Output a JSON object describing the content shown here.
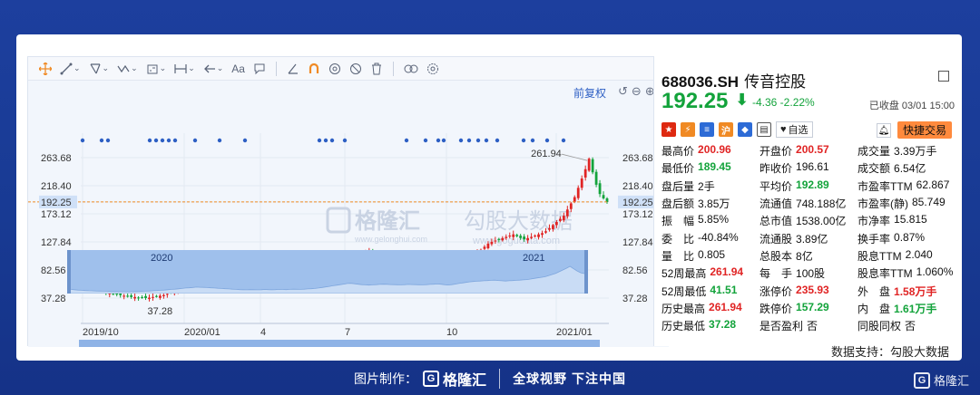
{
  "toolbar": {
    "icons": [
      "crosshair-icon",
      "line-icon",
      "fib-icon",
      "polyline-icon",
      "rect-tool-icon",
      "measure-icon",
      "arrow-icon",
      "text-icon",
      "comment-icon",
      "angle-icon",
      "magnet-icon",
      "eye-icon",
      "hide-icon",
      "trash-icon",
      "link-icon",
      "settings-icon"
    ],
    "text_tool_label": "Aa",
    "accent_color": "#f08a24"
  },
  "chart_controls": {
    "adjust_label": "前复权"
  },
  "watermark": {
    "brand": "格隆汇",
    "brand_sub": "www.gelonghui.com",
    "brand2": "勾股大数据",
    "brand2_sub": "www.gogudata.com"
  },
  "chart_data": {
    "type": "candlestick",
    "y_ticks_left": [
      "263.68",
      "218.40",
      "192.25",
      "173.12",
      "127.84",
      "82.56",
      "37.28"
    ],
    "y_ticks_right": [
      "263.68",
      "218.40",
      "192.25",
      "173.12",
      "127.84",
      "82.56",
      "37.28"
    ],
    "ylim": [
      37.28,
      263.68
    ],
    "x_ticks": [
      "2019/10",
      "2020/01",
      "4",
      "7",
      "10",
      "2021/01"
    ],
    "annotations": {
      "high_label": "261.94",
      "low_label": "37.28"
    },
    "last_price": "192.25",
    "navigator_labels": [
      "2020",
      "2021"
    ],
    "up_color": "#e02424",
    "down_color": "#13a33b",
    "series_close_estimate": [
      62,
      58,
      55,
      52,
      50,
      48,
      46,
      45,
      44,
      43,
      42,
      41,
      40,
      39,
      39,
      38,
      38,
      37.3,
      38,
      39,
      40,
      41,
      42,
      44,
      46,
      48,
      50,
      52,
      55,
      58,
      60,
      63,
      66,
      70,
      72,
      75,
      78,
      77,
      76,
      74,
      72,
      70,
      68,
      66,
      64,
      62,
      60,
      58,
      56,
      55,
      54,
      56,
      55,
      54,
      55,
      57,
      56,
      55,
      56,
      58,
      57,
      56,
      58,
      60,
      59,
      58,
      60,
      62,
      64,
      66,
      70,
      75,
      80,
      85,
      90,
      95,
      100,
      105,
      110,
      112,
      108,
      104,
      100,
      98,
      96,
      98,
      100,
      102,
      104,
      103,
      101,
      100,
      99,
      98,
      100,
      102,
      101,
      100,
      99,
      98,
      100,
      102,
      104,
      106,
      104,
      100,
      97,
      100,
      105,
      110,
      115,
      120,
      125,
      128,
      130,
      132,
      134,
      136,
      138,
      140,
      137,
      134,
      132,
      134,
      136,
      138,
      140,
      142,
      145,
      150,
      155,
      160,
      165,
      170,
      180,
      190,
      200,
      215,
      230,
      245,
      261.94,
      240,
      220,
      205,
      198,
      192.25
    ]
  },
  "quote": {
    "code": "688036.SH",
    "name": "传音控股",
    "price": "192.25",
    "arrow": "⬇",
    "change": "-4.36  -2.22%",
    "status": "已收盘 03/01 15:00",
    "favorite_label": "自选",
    "trade_label": "快捷交易",
    "icons": [
      "china-flag-icon",
      "lightning-icon",
      "database-icon",
      "sh-icon",
      "tag-icon",
      "doc-icon"
    ],
    "rows": [
      [
        [
          "最高价",
          "200.96",
          "up"
        ],
        [
          "开盘价",
          "200.57",
          "up"
        ],
        [
          "成交量",
          "3.39万手",
          ""
        ]
      ],
      [
        [
          "最低价",
          "189.45",
          "down"
        ],
        [
          "昨收价",
          "196.61",
          ""
        ],
        [
          "成交额",
          "6.54亿",
          ""
        ]
      ],
      [
        [
          "盘后量",
          "2手",
          ""
        ],
        [
          "平均价",
          "192.89",
          "down"
        ],
        [
          "市盈率TTM",
          "62.867",
          ""
        ]
      ],
      [
        [
          "盘后额",
          "3.85万",
          ""
        ],
        [
          "流通值",
          "748.188亿",
          ""
        ],
        [
          "市盈率(静)",
          "85.749",
          ""
        ]
      ],
      [
        [
          "振　幅",
          "5.85%",
          ""
        ],
        [
          "总市值",
          "1538.00亿",
          ""
        ],
        [
          "市净率",
          "15.815",
          ""
        ]
      ],
      [
        [
          "委　比",
          "-40.84%",
          ""
        ],
        [
          "流通股",
          "3.89亿",
          ""
        ],
        [
          "换手率",
          "0.87%",
          ""
        ]
      ],
      [
        [
          "量　比",
          "0.805",
          ""
        ],
        [
          "总股本",
          "8亿",
          ""
        ],
        [
          "股息TTM",
          "2.040",
          ""
        ]
      ],
      [
        [
          "52周最高",
          "261.94",
          "up"
        ],
        [
          "每　手",
          "100股",
          ""
        ],
        [
          "股息率TTM",
          "1.060%",
          ""
        ]
      ],
      [
        [
          "52周最低",
          "41.51",
          "down"
        ],
        [
          "涨停价",
          "235.93",
          "up"
        ],
        [
          "外　盘",
          "1.58万手",
          "up"
        ]
      ],
      [
        [
          "历史最高",
          "261.94",
          "up"
        ],
        [
          "跌停价",
          "157.29",
          "down"
        ],
        [
          "内　盘",
          "1.61万手",
          "down"
        ]
      ],
      [
        [
          "历史最低",
          "37.28",
          "down"
        ],
        [
          "是否盈利",
          "否",
          ""
        ],
        [
          "同股同权",
          "否",
          ""
        ]
      ]
    ]
  },
  "data_source": "数据支持：勾股大数据",
  "footer": {
    "made_by": "图片制作：",
    "brand": "格隆汇",
    "slogan": "全球视野  下注中国",
    "corner_brand": "格隆汇"
  }
}
